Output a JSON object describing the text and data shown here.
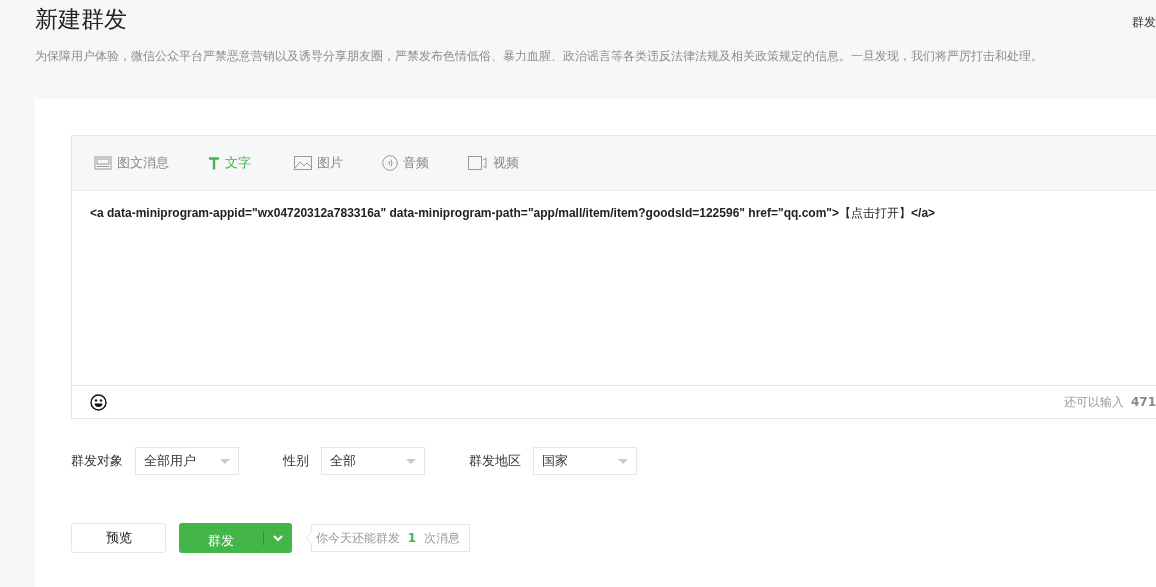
{
  "page": {
    "title": "新建群发",
    "corner_link": "群发",
    "notice": "为保障用户体验，微信公众平台严禁恶意营销以及诱导分享朋友圈，严禁发布色情低俗、暴力血腥、政治谣言等各类违反法律法规及相关政策规定的信息。一旦发现，我们将严厉打击和处理。"
  },
  "editor": {
    "tabs": [
      {
        "label": "图文消息",
        "kind": "news",
        "selected": false
      },
      {
        "label": "文字",
        "kind": "text",
        "selected": true
      },
      {
        "label": "图片",
        "kind": "image",
        "selected": false
      },
      {
        "label": "音频",
        "kind": "audio",
        "selected": false
      },
      {
        "label": "视频",
        "kind": "video",
        "selected": false
      }
    ],
    "content": "**<a data-miniprogram-appid=\"wx04720312a783316a\" data-miniprogram-path=\"app/mall/item/item?goodsId=122596\" href=\"qq.com\">**【点击打开】**</a>**",
    "counter": "还可以输入 **471**"
  },
  "filters": [
    {
      "label": "群发对象",
      "value": "全部用户"
    },
    {
      "label": "性别",
      "value": "全部"
    },
    {
      "label": "群发地区",
      "value": "国家"
    }
  ],
  "actions": {
    "preview": "预览",
    "send": "群发",
    "tip": "你今天还能群发 **1** 次消息"
  }
}
